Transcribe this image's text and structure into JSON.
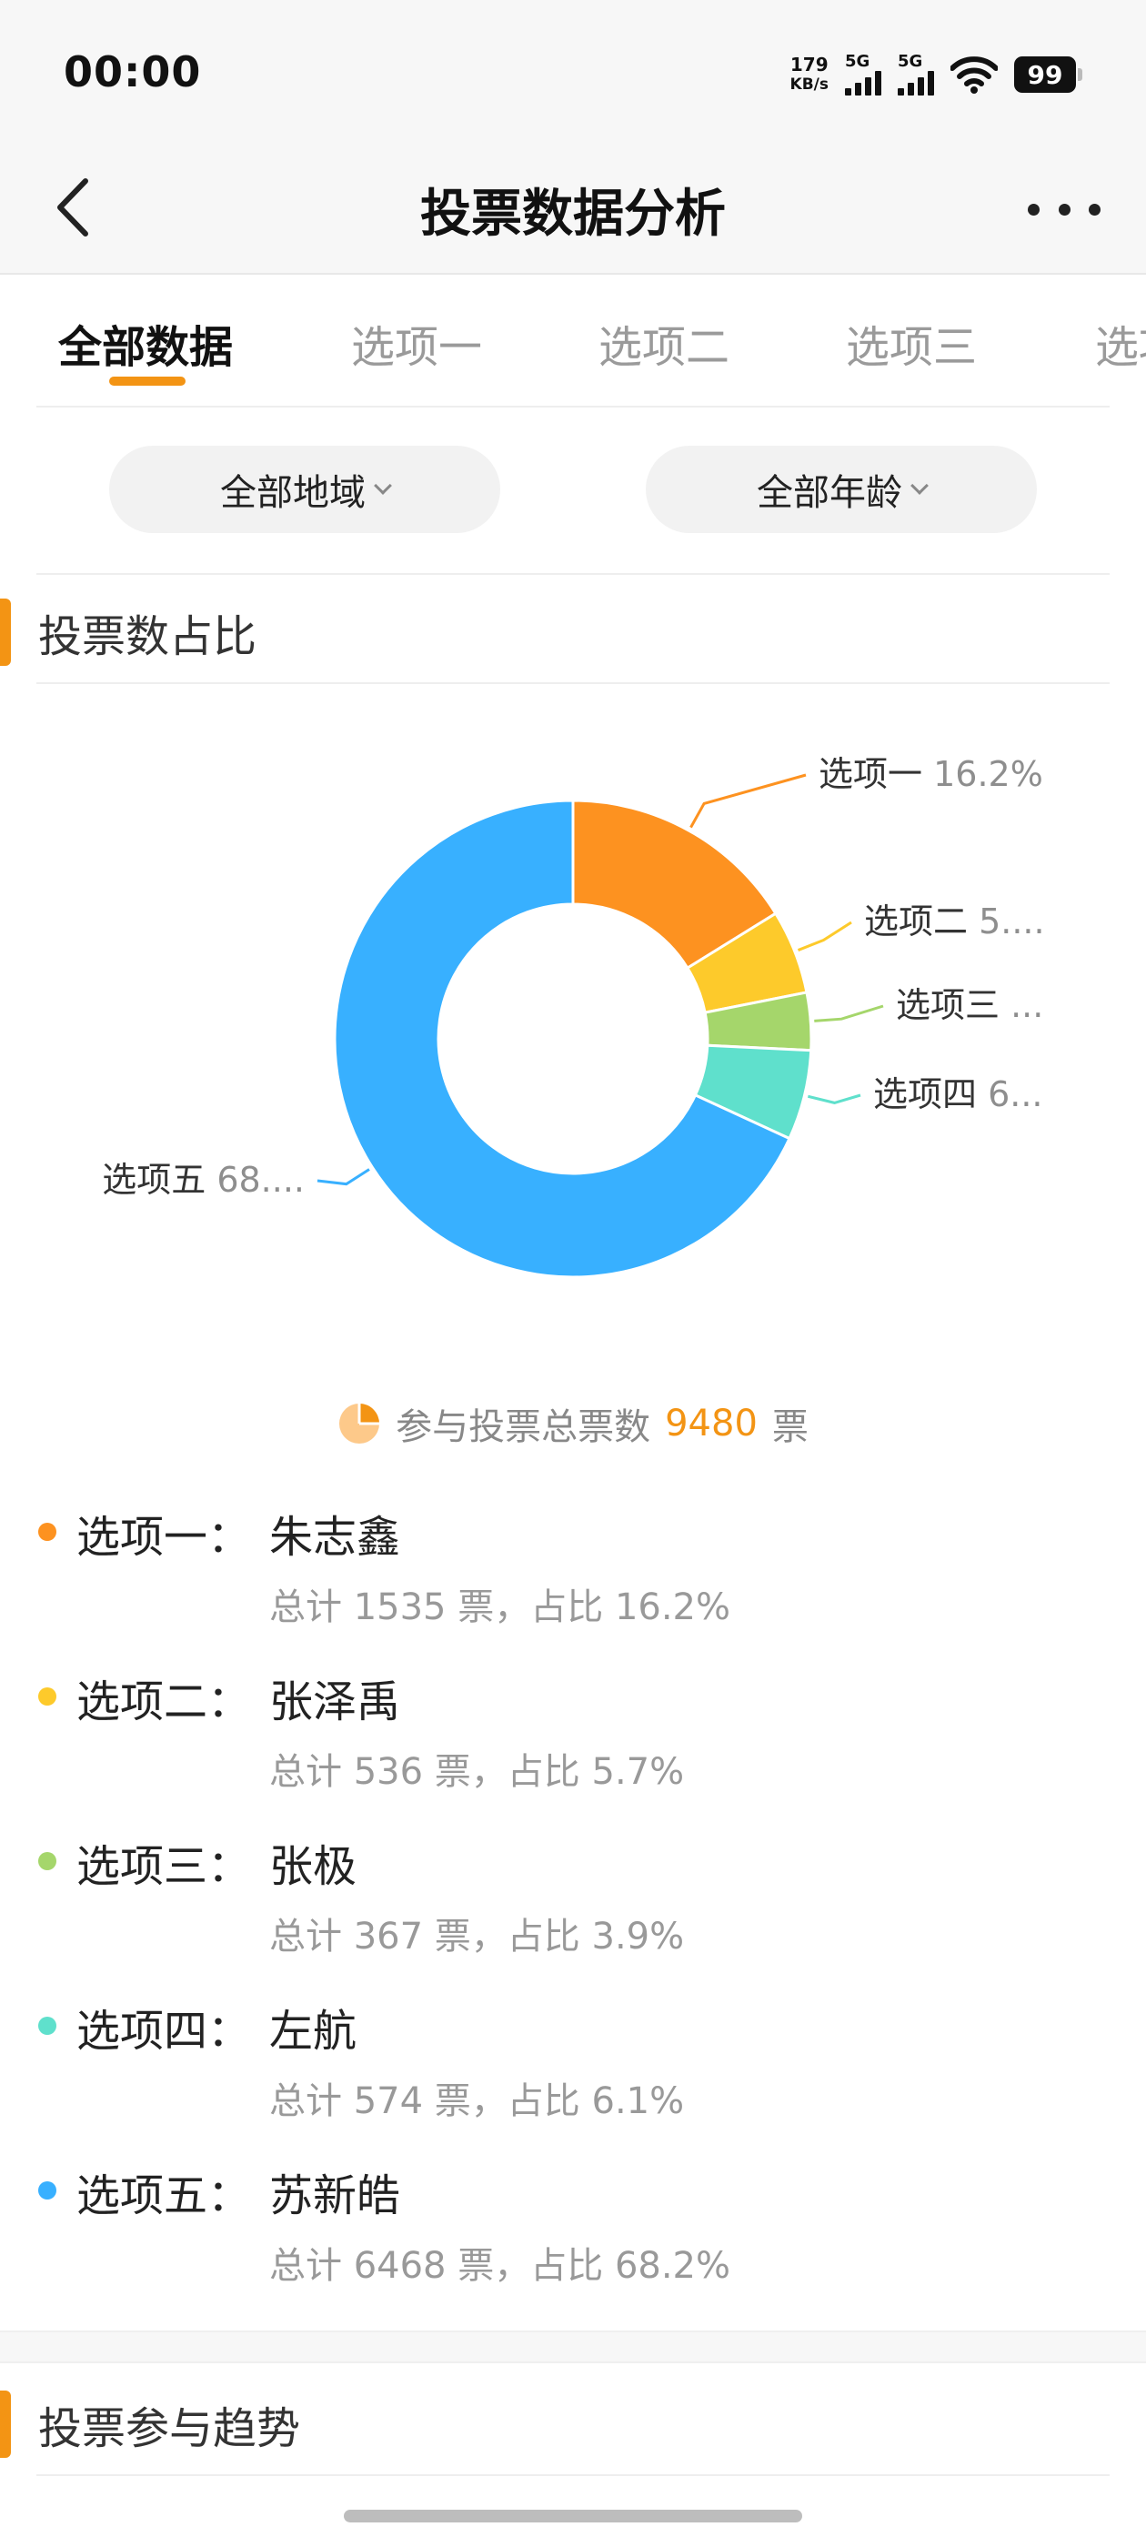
{
  "status_bar": {
    "time": "00:00",
    "net_speed_value": "179",
    "net_speed_unit": "KB/s",
    "signal1_label": "5G",
    "signal2_label": "5G",
    "battery": "99",
    "icons": [
      "signal-icon",
      "wifi-icon",
      "battery-icon"
    ]
  },
  "nav": {
    "title": "投票数据分析",
    "back_icon": "chevron-left-icon",
    "more_icon": "more-horizontal-icon"
  },
  "tabs": [
    {
      "label": "全部数据",
      "active": true
    },
    {
      "label": "选项一",
      "active": false
    },
    {
      "label": "选项二",
      "active": false
    },
    {
      "label": "选项三",
      "active": false
    },
    {
      "label": "选项",
      "active": false
    }
  ],
  "filters": {
    "region": "全部地域",
    "age": "全部年龄"
  },
  "section1": {
    "title": "投票数占比"
  },
  "chart_data": {
    "type": "pie",
    "style": "donut",
    "categories": [
      "选项一",
      "选项二",
      "选项三",
      "选项四",
      "选项五"
    ],
    "values": [
      16.2,
      5.7,
      3.9,
      6.1,
      68.2
    ],
    "display_labels": [
      {
        "name": "选项一",
        "pct": "16.2%"
      },
      {
        "name": "选项二",
        "pct": "5...."
      },
      {
        "name": "选项三",
        "pct": "..."
      },
      {
        "name": "选项四",
        "pct": "6..."
      },
      {
        "name": "选项五",
        "pct": "68...."
      }
    ],
    "colors": [
      "#fd9220",
      "#fdca2b",
      "#a5d66b",
      "#5fe0cc",
      "#38b0ff"
    ]
  },
  "total": {
    "prefix": "参与投票总票数",
    "value": "9480",
    "suffix": "票",
    "icon": "pie-chart-icon"
  },
  "options": [
    {
      "label": "选项一：",
      "name": "朱志鑫",
      "detail": "总计 1535 票，占比 16.2%",
      "color": "#fd9220"
    },
    {
      "label": "选项二：",
      "name": "张泽禹",
      "detail": "总计 536 票，占比 5.7%",
      "color": "#fdca2b"
    },
    {
      "label": "选项三：",
      "name": "张极",
      "detail": "总计 367 票，占比 3.9%",
      "color": "#a5d66b"
    },
    {
      "label": "选项四：",
      "name": "左航",
      "detail": "总计 574 票，占比 6.1%",
      "color": "#5fe0cc"
    },
    {
      "label": "选项五：",
      "name": "苏新皓",
      "detail": "总计 6468 票，占比 68.2%",
      "color": "#38b0ff"
    }
  ],
  "section2": {
    "title": "投票参与趋势"
  }
}
